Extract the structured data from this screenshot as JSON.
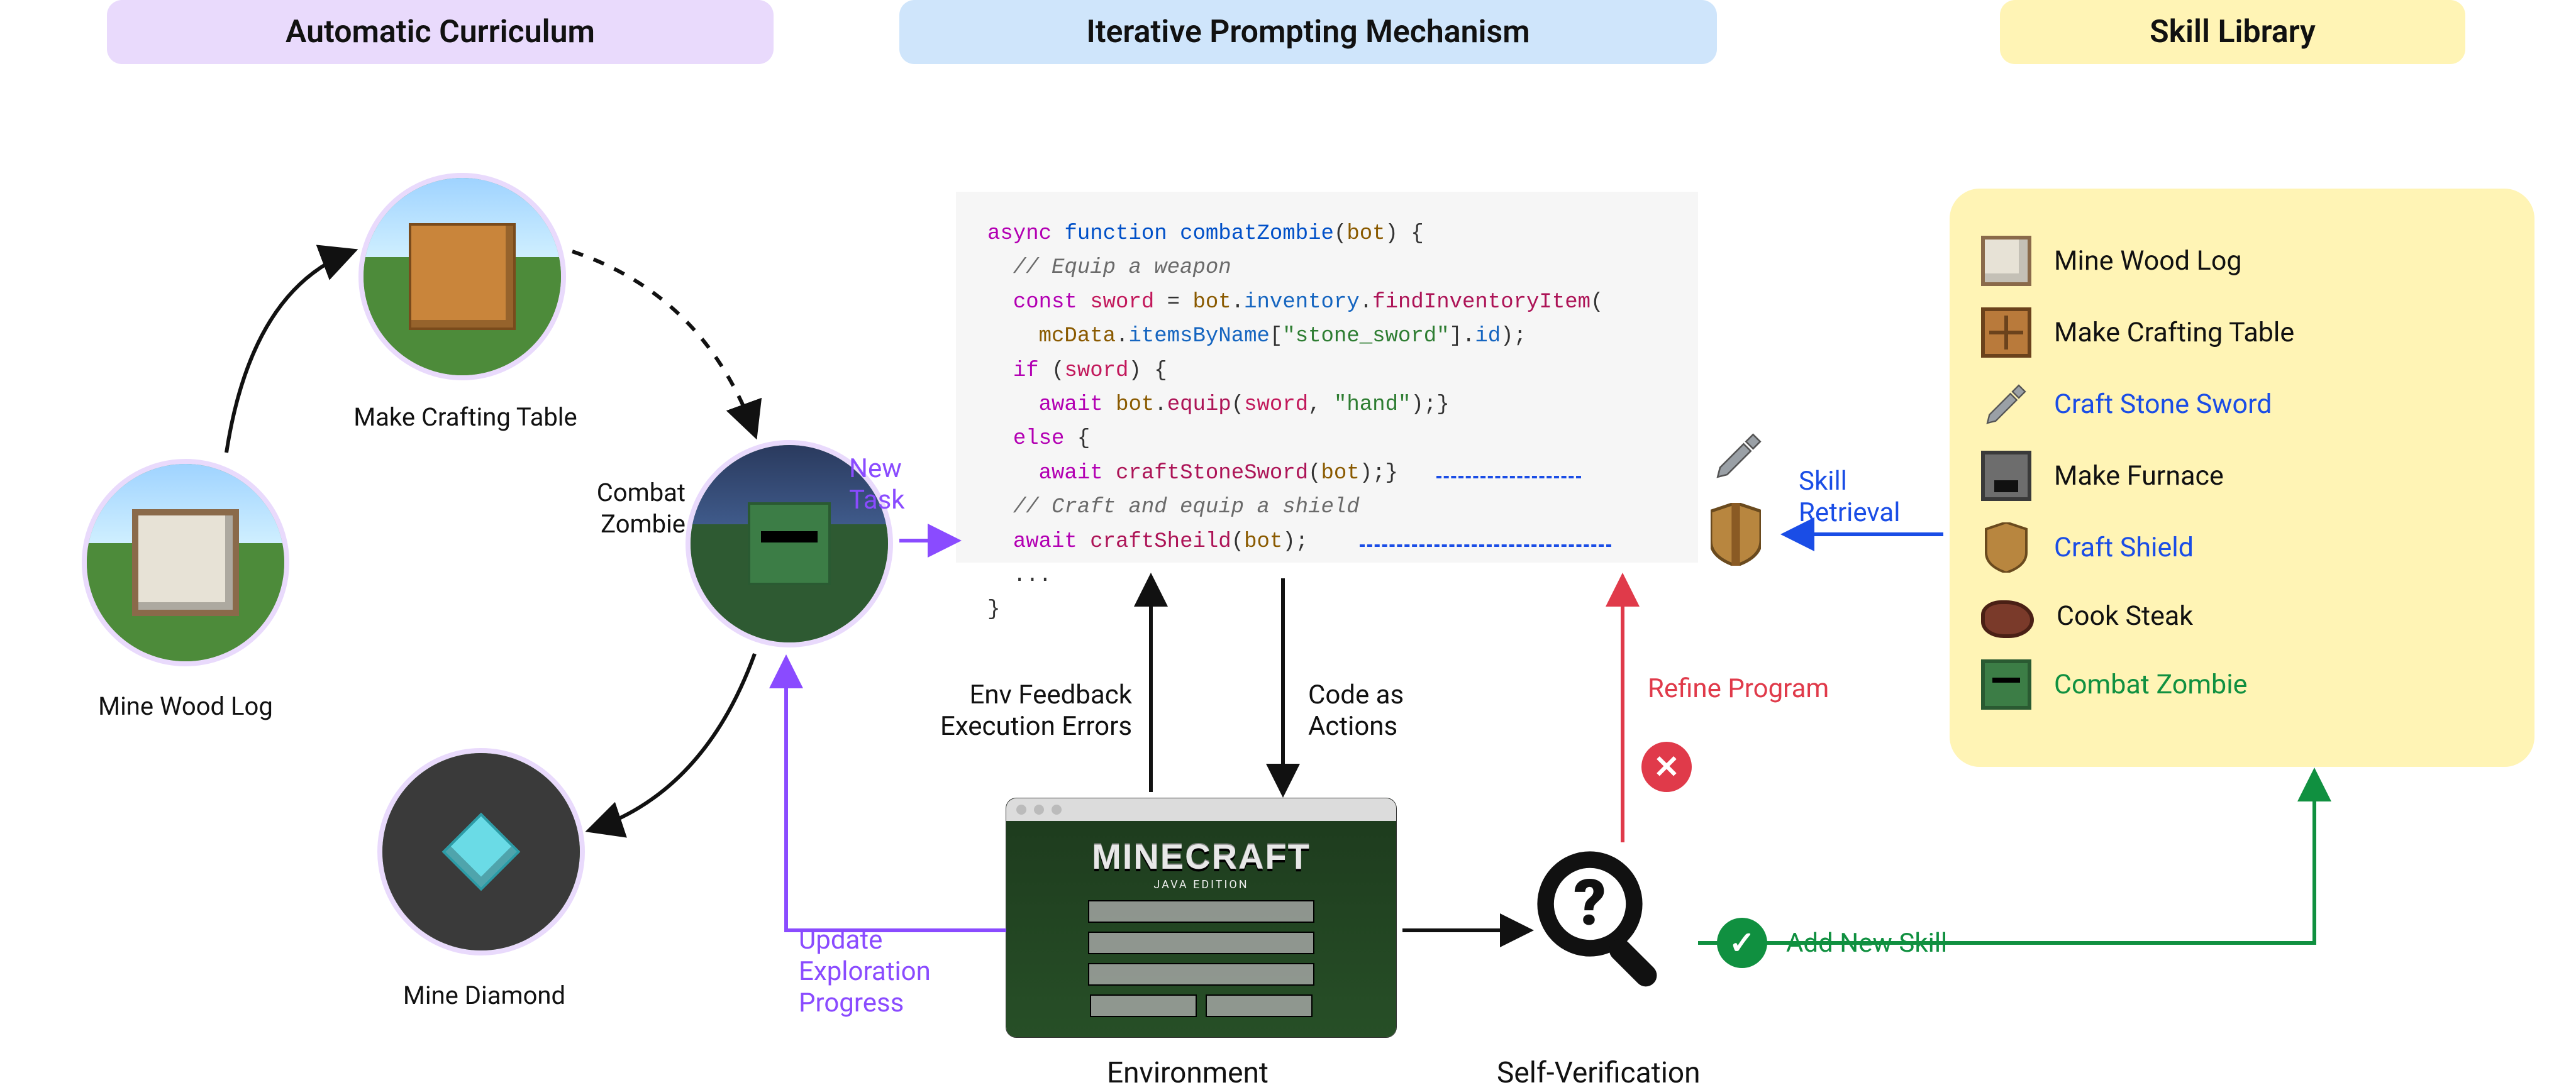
{
  "headers": {
    "curriculum": "Automatic Curriculum",
    "prompting": "Iterative Prompting Mechanism",
    "skill": "Skill Library"
  },
  "curriculum": {
    "craft_table": "Make Crafting Table",
    "mine_wood": "Mine Wood Log",
    "combat_zombie_l1": "Combat",
    "combat_zombie_l2": "Zombie",
    "mine_diamond": "Mine Diamond"
  },
  "labels": {
    "new_task_l1": "New",
    "new_task_l2": "Task",
    "env_feedback_l1": "Env Feedback",
    "env_feedback_l2": "Execution Errors",
    "code_actions_l1": "Code as",
    "code_actions_l2": "Actions",
    "refine": "Refine Program",
    "skill_retrieval_l1": "Skill",
    "skill_retrieval_l2": "Retrieval",
    "update_l1": "Update",
    "update_l2": "Exploration",
    "update_l3": "Progress",
    "add_skill": "Add New Skill",
    "environment": "Environment",
    "self_verification": "Self-Verification"
  },
  "env_card": {
    "logo": "MINECRAFT",
    "sub": "JAVA EDITION"
  },
  "magnifier_q": "?",
  "status": {
    "x": "✕",
    "check": "✓"
  },
  "code": {
    "l1a": "async",
    "l1b": "function",
    "l1c": "combatZombie",
    "l1d": "bot",
    "l1e": ") {",
    "l2": "// Equip a weapon",
    "l3a": "const",
    "l3b": "sword",
    "l3c": " = ",
    "l3d": "bot",
    "l3e": ".",
    "l3f": "inventory",
    "l3g": ".",
    "l3h": "findInventoryItem",
    "l3i": "(",
    "l4a": "mcData",
    "l4b": ".",
    "l4c": "itemsByName",
    "l4d": "[",
    "l4e": "\"stone_sword\"",
    "l4f": "].",
    "l4g": "id",
    "l4h": ");",
    "l5a": "if",
    "l5b": " (",
    "l5c": "sword",
    "l5d": ") {",
    "l6a": "await",
    "l6b": " ",
    "l6c": "bot",
    "l6d": ".",
    "l6e": "equip",
    "l6f": "(",
    "l6g": "sword",
    "l6h": ", ",
    "l6i": "\"hand\"",
    "l6j": ");}",
    "l7a": "else",
    "l7b": " {",
    "l8a": "await",
    "l8b": " ",
    "l8c": "craftStoneSword",
    "l8d": "(",
    "l8e": "bot",
    "l8f": ");}",
    "l9": "// Craft and equip a shield",
    "l10a": "await",
    "l10b": " ",
    "l10c": "craftSheild",
    "l10d": "(",
    "l10e": "bot",
    "l10f": ");",
    "l11": "...",
    "l12": "}"
  },
  "skills": {
    "s1": "Mine Wood  Log",
    "s2": "Make Crafting Table",
    "s3": "Craft Stone Sword",
    "s4": "Make Furnace",
    "s5": "Craft Shield",
    "s6": "Cook Steak",
    "s7": "Combat Zombie"
  }
}
